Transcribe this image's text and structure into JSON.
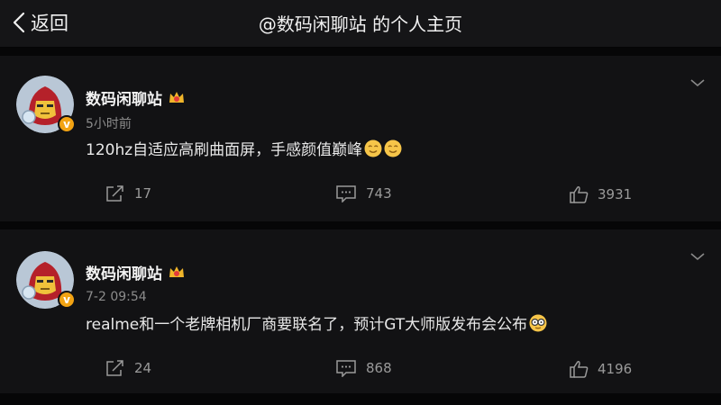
{
  "header": {
    "back_label": "返回",
    "title": "@数码闲聊站 的个人主页"
  },
  "posts": [
    {
      "author": "数码闲聊站",
      "time": "5小时前",
      "text": "120hz自适应高刷曲面屏，手感颜值巅峰",
      "emojis": [
        "smirk-emoji",
        "smirk-emoji"
      ],
      "reposts": "17",
      "comments": "743",
      "likes": "3931"
    },
    {
      "author": "数码闲聊站",
      "time": "7-2 09:54",
      "text": "realme和一个老牌相机厂商要联名了，预计GT大师版发布会公布",
      "emojis": [
        "glasses-emoji"
      ],
      "reposts": "24",
      "comments": "868",
      "likes": "4196"
    }
  ],
  "colors": {
    "background": "#0e0e10",
    "card": "#121214",
    "verified_badge": "#f2a313",
    "crown": "#f0b52a"
  }
}
